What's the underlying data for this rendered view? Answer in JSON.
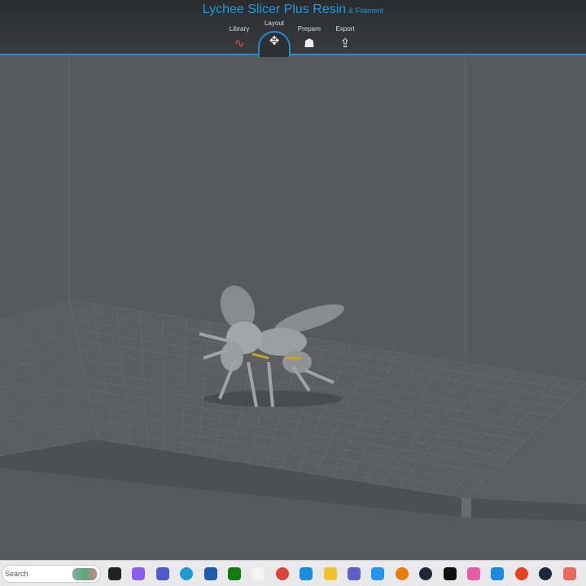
{
  "app": {
    "title": "Lychee Slicer Plus Resin",
    "title_suffix": "& Filament"
  },
  "tabs": [
    {
      "label": "Library",
      "icon": "library-icon"
    },
    {
      "label": "Layout",
      "icon": "move-icon",
      "active": true
    },
    {
      "label": "Prepare",
      "icon": "supports-icon"
    },
    {
      "label": "Export",
      "icon": "export-icon"
    }
  ],
  "taskbar": {
    "search_placeholder": "Search",
    "icons": [
      {
        "name": "task-view-icon",
        "color": "#222"
      },
      {
        "name": "copilot-icon",
        "color": "#8a5cf0"
      },
      {
        "name": "teams-icon",
        "color": "#5059c9"
      },
      {
        "name": "edge-icon",
        "color": "#1c9ad6"
      },
      {
        "name": "store-icon",
        "color": "#1b5fa8"
      },
      {
        "name": "xbox-icon",
        "color": "#107c10"
      },
      {
        "name": "file-icon",
        "color": "#f4f4f4"
      },
      {
        "name": "chrome-icon",
        "color": "#db4437"
      },
      {
        "name": "vpn-icon",
        "color": "#1a8fe0"
      },
      {
        "name": "file-explorer-icon",
        "color": "#f2c12e"
      },
      {
        "name": "apps-grid-icon",
        "color": "#5b5fc7"
      },
      {
        "name": "messenger-icon",
        "color": "#2196f3"
      },
      {
        "name": "blender-icon",
        "color": "#e87d0d"
      },
      {
        "name": "steam-icon",
        "color": "#1b2838"
      },
      {
        "name": "terminal-icon",
        "color": "#111"
      },
      {
        "name": "itunes-icon",
        "color": "#e85ba8"
      },
      {
        "name": "gem-icon",
        "color": "#1e88e5"
      },
      {
        "name": "ea-icon",
        "color": "#e8401c"
      },
      {
        "name": "steam-icon-2",
        "color": "#1b2838"
      },
      {
        "name": "lychee-icon",
        "color": "#e86a5a"
      }
    ]
  }
}
